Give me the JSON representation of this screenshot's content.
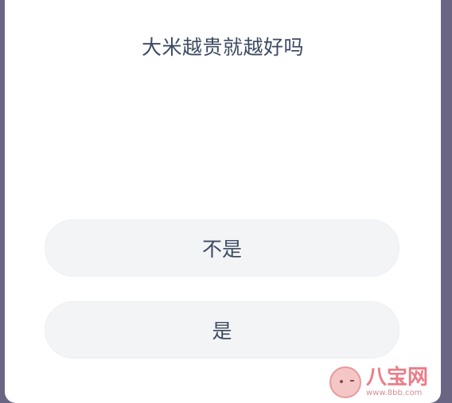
{
  "quiz": {
    "question": "大米越贵就越好吗",
    "options": [
      {
        "label": "不是"
      },
      {
        "label": "是"
      }
    ]
  },
  "watermark": {
    "brand": "八宝网",
    "url": "www.8bb.com"
  },
  "colors": {
    "background": "#6b6584",
    "card": "#ffffff",
    "option_bg": "#f3f4f6",
    "text": "#3d4a62",
    "watermark": "#e97d88"
  }
}
